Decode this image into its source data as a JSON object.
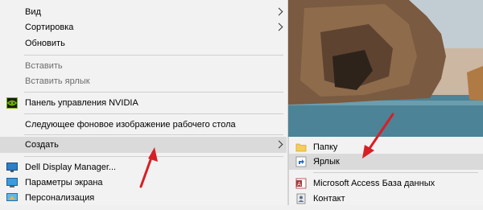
{
  "menu": {
    "items": [
      {
        "label": "Вид",
        "submenu": true
      },
      {
        "label": "Сортировка",
        "submenu": true
      },
      {
        "label": "Обновить"
      },
      {
        "label": "Вставить",
        "disabled": true
      },
      {
        "label": "Вставить ярлык",
        "disabled": true
      },
      {
        "label": "Панель управления NVIDIA",
        "icon": "nvidia-icon"
      },
      {
        "label": "Следующее фоновое изображение рабочего стола"
      },
      {
        "label": "Создать",
        "submenu": true,
        "highlighted": true
      },
      {
        "label": "Dell Display Manager...",
        "icon": "dell-display-icon"
      },
      {
        "label": "Параметры экрана",
        "icon": "display-settings-icon"
      },
      {
        "label": "Персонализация",
        "icon": "personalization-icon"
      }
    ]
  },
  "submenu": {
    "items": [
      {
        "label": "Папку",
        "icon": "folder-icon"
      },
      {
        "label": "Ярлык",
        "icon": "shortcut-icon",
        "highlighted": true
      },
      {
        "label": "Microsoft Access База данных",
        "icon": "access-icon"
      },
      {
        "label": "Контакт",
        "icon": "contact-icon"
      }
    ]
  },
  "colors": {
    "menu_bg": "#f2f2f2",
    "highlight": "#dadada",
    "annotation": "#d71f26",
    "nvidia_green": "#76b900"
  }
}
